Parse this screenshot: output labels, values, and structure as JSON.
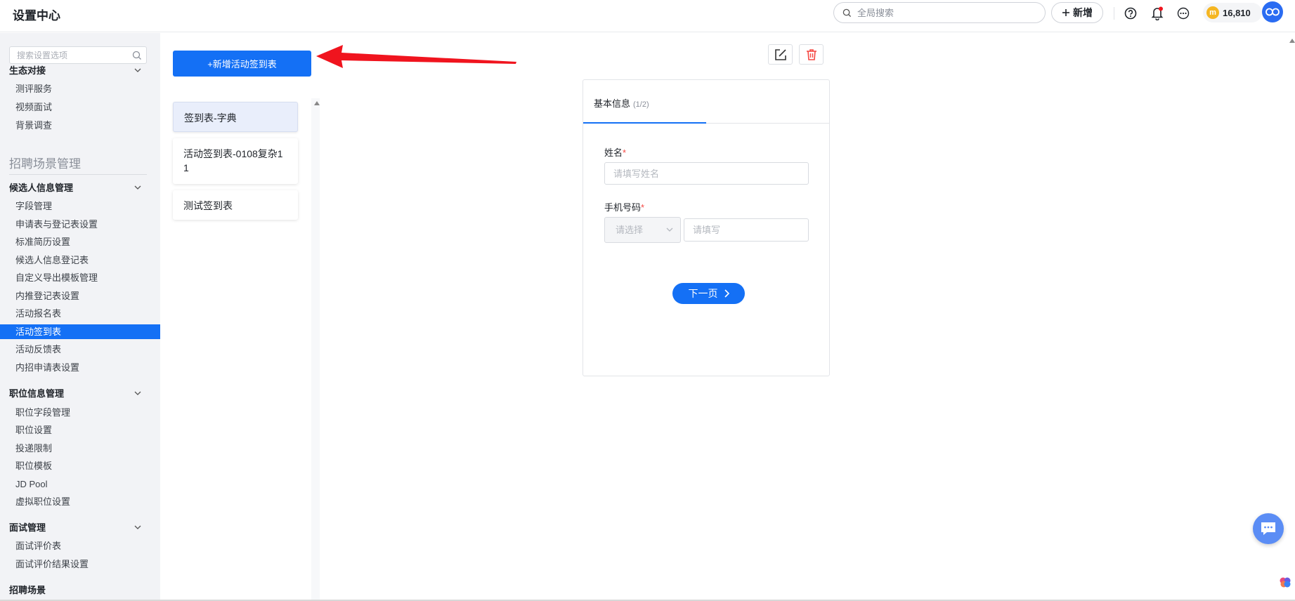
{
  "header": {
    "title": "设置中心",
    "search_placeholder": "全局搜索",
    "new_label": "新增",
    "coins": "16,810",
    "coin_symbol": "m"
  },
  "sidebar": {
    "search_placeholder": "搜索设置选项",
    "groups": [
      {
        "label": "生态对接",
        "items": [
          "测评服务",
          "视频面试",
          "背景调查"
        ]
      },
      {
        "label": "候选人信息管理",
        "items": [
          "字段管理",
          "申请表与登记表设置",
          "标准简历设置",
          "候选人信息登记表",
          "自定义导出模板管理",
          "内推登记表设置",
          "活动报名表",
          "活动签到表",
          "活动反馈表",
          "内招申请表设置"
        ]
      },
      {
        "label": "职位信息管理",
        "items": [
          "职位字段管理",
          "职位设置",
          "投递限制",
          "职位模板",
          "JD Pool",
          "虚拟职位设置"
        ]
      },
      {
        "label": "面试管理",
        "items": [
          "面试评价表",
          "面试评价结果设置"
        ]
      }
    ],
    "section_title": "招聘场景管理",
    "active_item": "活动签到表",
    "cut_off_label": "招聘场景"
  },
  "main": {
    "add_button": "+新增活动签到表",
    "list": [
      {
        "label": "签到表-字典",
        "selected": true
      },
      {
        "label": "活动签到表-0108复杂11",
        "selected": false
      },
      {
        "label": "测试签到表",
        "selected": false
      }
    ],
    "form": {
      "tab_title": "基本信息",
      "tab_count": "(1/2)",
      "name_label": "姓名",
      "name_placeholder": "请填写姓名",
      "phone_label": "手机号码",
      "phone_select_placeholder": "请选择",
      "phone_placeholder": "请填写",
      "required_mark": "*",
      "next_button": "下一页"
    }
  },
  "colors": {
    "primary": "#1470f5",
    "annotation_arrow": "#f0141e",
    "delete": "#f54a45"
  }
}
